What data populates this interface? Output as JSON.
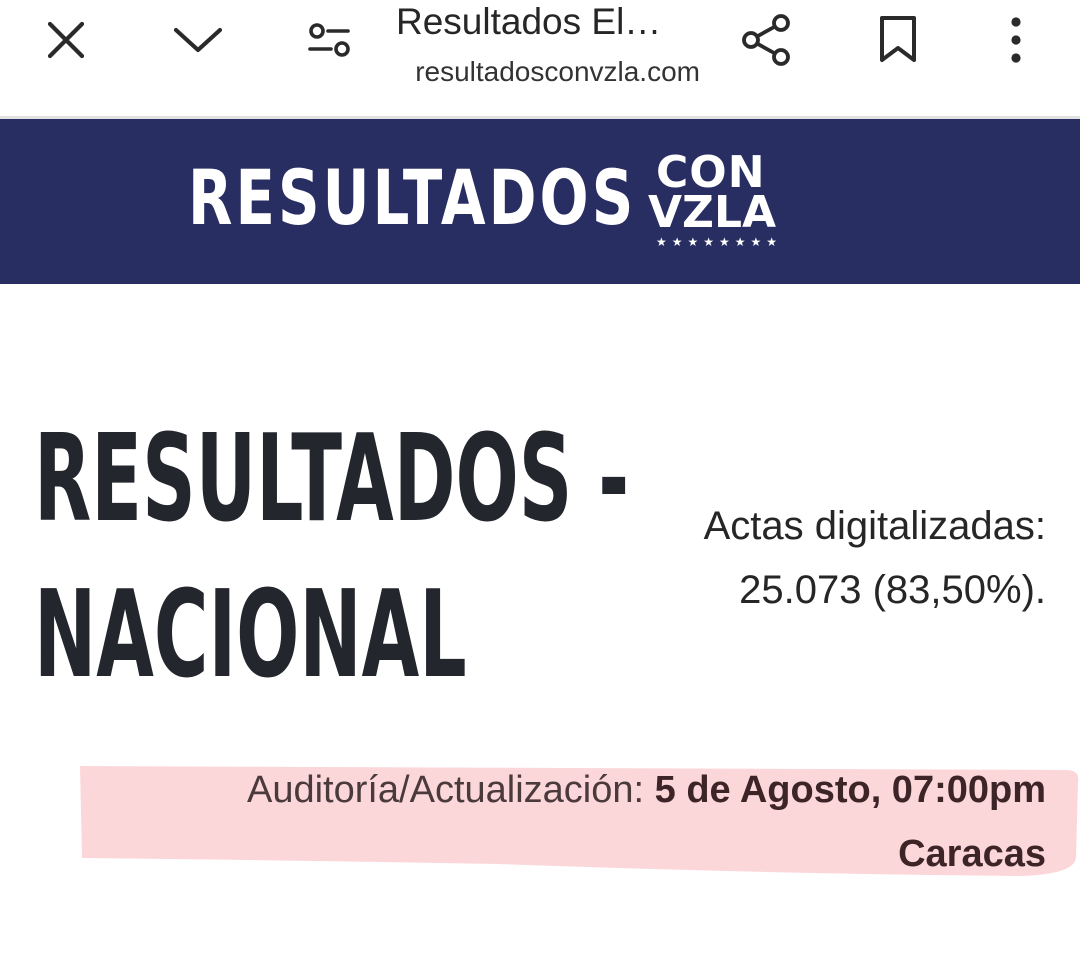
{
  "browser": {
    "tab_title": "Resultados El…",
    "url": "resultadosconvzla.com",
    "icons": {
      "close": "close-icon",
      "collapse": "chevron-down-icon",
      "tune": "tune-icon",
      "share": "share-icon",
      "bookmark": "bookmark-icon",
      "more": "more-vert-icon"
    }
  },
  "site_header": {
    "logo_text": "RESULTADOS",
    "badge_line1": "CON",
    "badge_line2": "VZLA",
    "badge_stars": "★★★★★★★★",
    "background_color": "#282e62"
  },
  "content": {
    "title_line1": "RESULTADOS -",
    "title_line2": "NACIONAL",
    "actas_label": "Actas digitalizadas:",
    "actas_value": "25.073 (83,50%).",
    "audit_label": "Auditoría/Actualización:",
    "audit_date": "5 de Agosto, 07:00pm",
    "audit_city": "Caracas",
    "highlight_color": "#fbd7da"
  }
}
